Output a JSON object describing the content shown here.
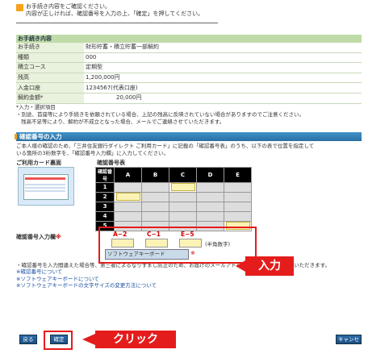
{
  "notice": {
    "line1": "お手続き内容をご確認ください。",
    "line2": "内容が正しければ、確認番号を入力の上、「確定」を押してください。"
  },
  "details": {
    "title": "お手続き内容",
    "rows": [
      {
        "label": "お手続き",
        "value": "財形貯蓄・積立貯蓄一部解約"
      },
      {
        "label": "種類",
        "value": "000"
      },
      {
        "label": "積立コース",
        "value": "定期型"
      },
      {
        "label": "残高",
        "value": "1,200,000円"
      },
      {
        "label": "入金口座",
        "value": "1234567(代表口座)"
      },
      {
        "label": "解約金額*",
        "value": "20,000円"
      }
    ],
    "required_note": "*入力・選択項目",
    "note1": "・別途、首座等により手続きを依頼されている場合、上記の残高に反映されていない場合がありますのでご注意ください。",
    "note2": "残高不足等により、解約が不成立となった場合、メールでご連絡させていただきます。"
  },
  "confirm": {
    "title": "確認番号の入力",
    "desc1": "ご本人様の確認のため、「三井住友銀行ダイレクト ご利用カード」に記載の「確認番号表」のうち、以下の表で位置を指定して",
    "desc2": "いる箇所の3桁数字を、「確認番号入力欄」に入力してください。",
    "card_label": "ご利用カード裏面",
    "table_label": "確認番号表",
    "table_corner": "確認番号",
    "columns": [
      "A",
      "B",
      "C",
      "D",
      "E"
    ],
    "rows": [
      "1",
      "2",
      "3",
      "4",
      "5"
    ],
    "input_label": "確認番号入力欄",
    "input_star": "※",
    "fields": [
      "A−2",
      "C−1",
      "E−5"
    ],
    "hint": "(半角数字)",
    "soft_keyboard": "ソフトウェアキーボード",
    "soft_star": "※"
  },
  "callouts": {
    "input": "入力",
    "click": "クリック"
  },
  "notes": {
    "n1": "・確認番号を入力間違えた場合等、第三者によるなりすまし防止のため、お届けのメールアドレス宛てにご連絡させていただきます。",
    "links": [
      "※確認番号について",
      "※ソフトウェアキーボードについて",
      "※ソフトウェアキーボードの文字サイズの変更方法について"
    ]
  },
  "buttons": {
    "back": "戻る",
    "confirm": "確定",
    "cancel": "キャンセル"
  },
  "colors": {
    "accent_red": "#e51c1c",
    "header_green": "#bfdba8",
    "title_blue": "#2a6fa3",
    "highlight": "#fbf3b6"
  }
}
